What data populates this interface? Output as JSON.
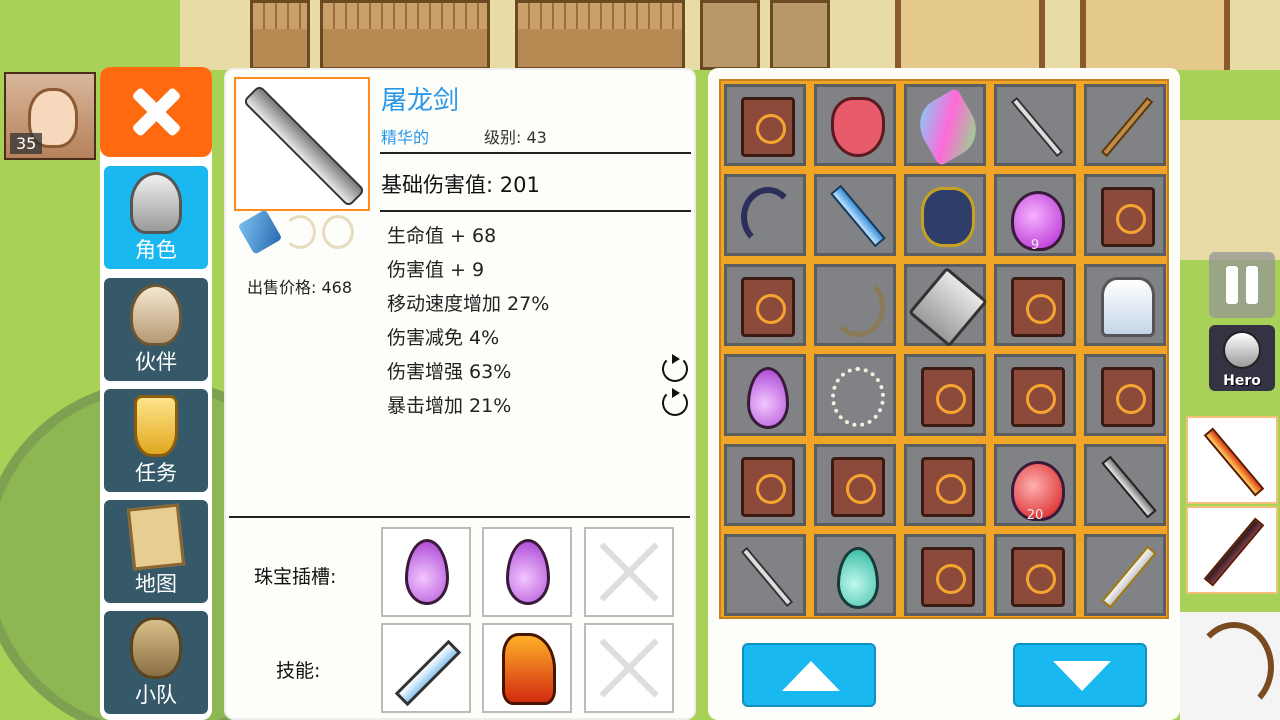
{
  "player": {
    "level": "35"
  },
  "nav": {
    "items": [
      {
        "label": "角色",
        "icon": "knight-helmet-icon",
        "active": true
      },
      {
        "label": "伙伴",
        "icon": "horned-helmet-icon",
        "active": false
      },
      {
        "label": "任务",
        "icon": "trophy-icon",
        "active": false
      },
      {
        "label": "地图",
        "icon": "map-scroll-icon",
        "active": false
      },
      {
        "label": "小队",
        "icon": "party-icon",
        "active": false
      }
    ]
  },
  "item": {
    "name": "屠龙剑",
    "rarity": "精华的",
    "level_label": "级别: 43",
    "base_damage": "基础伤害值: 201",
    "stats": [
      "生命值 + 68",
      "伤害值 + 9",
      "移动速度增加 27%",
      "伤害减免 4%",
      "伤害增强 63%",
      "暴击增加 21%"
    ],
    "sell_price": "出售价格: 468",
    "gem_slots_label": "珠宝插槽:",
    "skills_label": "技能:"
  },
  "inventory": {
    "rows": [
      [
        {
          "icon": "spellbook-icon"
        },
        {
          "icon": "demon-mask-icon"
        },
        {
          "icon": "feather-icon"
        },
        {
          "icon": "katana-icon"
        },
        {
          "icon": "staff-icon"
        }
      ],
      [
        {
          "icon": "bow-icon"
        },
        {
          "icon": "blue-sword-icon"
        },
        {
          "icon": "helmet-icon"
        },
        {
          "icon": "purple-potion-icon",
          "qty": "9"
        },
        {
          "icon": "spellbook-icon"
        }
      ],
      [
        {
          "icon": "spellbook-icon"
        },
        {
          "icon": "longbow-icon"
        },
        {
          "icon": "cleaver-icon"
        },
        {
          "icon": "spellbook-icon"
        },
        {
          "icon": "cloak-icon"
        }
      ],
      [
        {
          "icon": "purple-gem-icon"
        },
        {
          "icon": "necklace-icon"
        },
        {
          "icon": "spellbook-icon"
        },
        {
          "icon": "spellbook-icon"
        },
        {
          "icon": "spellbook-icon"
        }
      ],
      [
        {
          "icon": "spellbook-icon"
        },
        {
          "icon": "spellbook-icon"
        },
        {
          "icon": "spellbook-icon"
        },
        {
          "icon": "red-potion-icon",
          "qty": "20"
        },
        {
          "icon": "dark-sword-icon"
        }
      ],
      [
        {
          "icon": "katana-icon"
        },
        {
          "icon": "teal-gem-icon"
        },
        {
          "icon": "spellbook-icon"
        },
        {
          "icon": "spellbook-icon"
        },
        {
          "icon": "golden-sword-icon"
        }
      ]
    ]
  },
  "hud": {
    "hero_label": "Hero"
  },
  "colors": {
    "accent": "#19b8f0",
    "close": "#ff6a10",
    "title": "#2a98e8",
    "grid": "#f0a526"
  }
}
